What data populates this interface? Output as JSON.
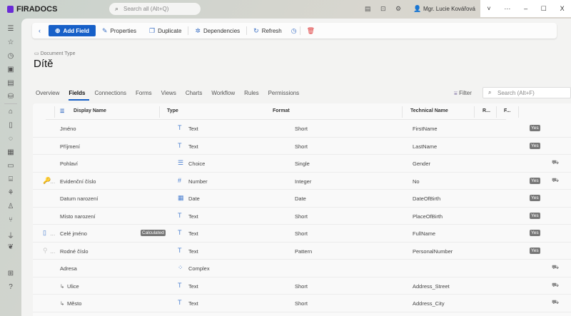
{
  "app": {
    "name": "FIRADOCS",
    "search_placeholder": "Search all (Alt+Q)",
    "user": "Mgr. Lucie Kovářová"
  },
  "window": {
    "controls": [
      "˅",
      "···",
      "–",
      "☐",
      "X"
    ]
  },
  "sidebar": {
    "icons": [
      "menu-icon",
      "star-icon",
      "history-icon",
      "document-icon",
      "archive-icon",
      "user-stack-icon",
      "home-icon",
      "file-icon",
      "chat-icon",
      "calendar-icon",
      "card-icon",
      "bank-icon",
      "tree-icon",
      "person-icon",
      "fork-knife-icon",
      "plug-icon",
      "plant-icon",
      "apps-icon",
      "help-icon"
    ]
  },
  "toolbar": {
    "add_field": "Add Field",
    "properties": "Properties",
    "duplicate": "Duplicate",
    "dependencies": "Dependencies",
    "refresh": "Refresh"
  },
  "page": {
    "breadcrumb": "Document Type",
    "title": "Dítě"
  },
  "tabs": [
    {
      "label": "Overview"
    },
    {
      "label": "Fields",
      "active": true
    },
    {
      "label": "Connections"
    },
    {
      "label": "Forms"
    },
    {
      "label": "Views"
    },
    {
      "label": "Charts"
    },
    {
      "label": "Workflow"
    },
    {
      "label": "Rules"
    },
    {
      "label": "Permissions"
    }
  ],
  "filter": {
    "label": "Filter",
    "search_placeholder": "Search (Alt+F)"
  },
  "table": {
    "columns": [
      "Display Name",
      "Type",
      "Format",
      "Technical Name",
      "R...",
      "F..."
    ],
    "rows": [
      {
        "name": "Jméno",
        "type": "Text",
        "type_icon": "T",
        "format": "Short",
        "tech": "FirstName",
        "r": "Yes",
        "car": false
      },
      {
        "name": "Příjmení",
        "type": "Text",
        "type_icon": "T",
        "format": "Short",
        "tech": "LastName",
        "r": "Yes",
        "car": false
      },
      {
        "name": "Pohlaví",
        "type": "Choice",
        "type_icon": "☰",
        "format": "Single",
        "tech": "Gender",
        "r": "",
        "car": true
      },
      {
        "name": "Evidenční číslo",
        "lead": "🔑",
        "type": "Number",
        "type_icon": "#",
        "format": "Integer",
        "tech": "No",
        "r": "Yes",
        "car": true
      },
      {
        "name": "Datum narození",
        "type": "Date",
        "type_icon": "▦",
        "format": "Date",
        "tech": "DateOfBirth",
        "r": "Yes",
        "car": false
      },
      {
        "name": "Místo narození",
        "type": "Text",
        "type_icon": "T",
        "format": "Short",
        "tech": "PlaceOfBirth",
        "r": "Yes",
        "car": false
      },
      {
        "name": "Celé jméno",
        "lead": "▯",
        "badge": "Calculated",
        "type": "Text",
        "type_icon": "T",
        "format": "Short",
        "tech": "FullName",
        "r": "Yes",
        "car": false
      },
      {
        "name": "Rodné číslo",
        "lead": "⚲",
        "type": "Text",
        "type_icon": "T",
        "format": "Pattern",
        "tech": "PersonalNumber",
        "r": "Yes",
        "car": false
      },
      {
        "name": "Adresa",
        "type": "Complex",
        "type_icon": "⁘",
        "format": "",
        "tech": "",
        "r": "",
        "car": true
      },
      {
        "name": "Ulice",
        "child": true,
        "type": "Text",
        "type_icon": "T",
        "format": "Short",
        "tech": "Address_Street",
        "r": "",
        "car": true
      },
      {
        "name": "Město",
        "child": true,
        "type": "Text",
        "type_icon": "T",
        "format": "Short",
        "tech": "Address_City",
        "r": "",
        "car": true
      }
    ]
  }
}
